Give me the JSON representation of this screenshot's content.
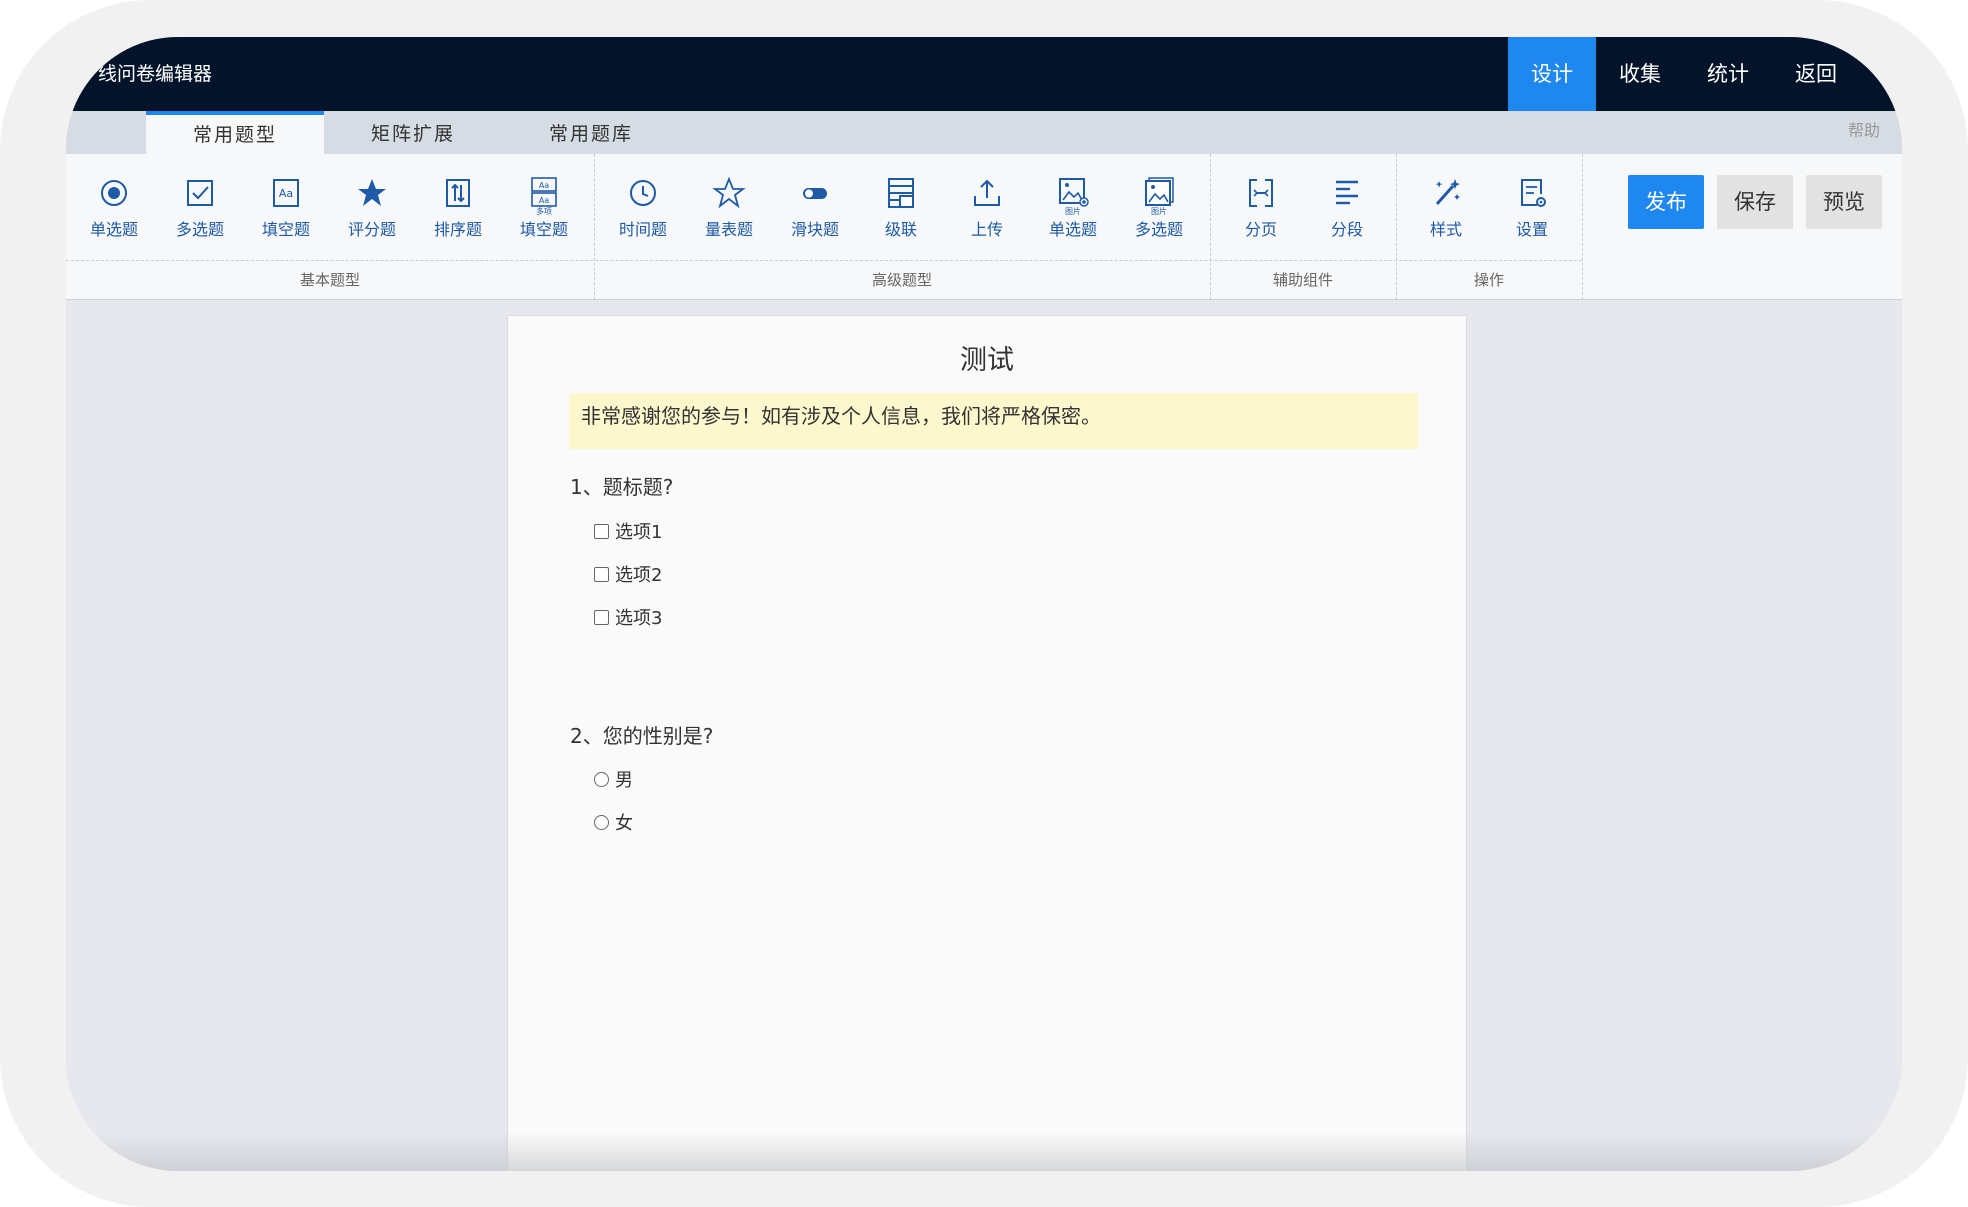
{
  "app": {
    "title": "线问卷编辑器"
  },
  "topnav": {
    "items": [
      "设计",
      "收集",
      "统计",
      "返回"
    ],
    "active": "设计"
  },
  "tabs": {
    "items": [
      "常用题型",
      "矩阵扩展",
      "常用题库"
    ],
    "active": "常用题型",
    "help": "帮助"
  },
  "toolbar": {
    "basic": [
      "单选题",
      "多选题",
      "填空题",
      "评分题",
      "排序题",
      "填空题"
    ],
    "advanced": [
      "时间题",
      "量表题",
      "滑块题",
      "级联",
      "上传",
      "单选题",
      "多选题"
    ],
    "aux": [
      "分页",
      "分段"
    ],
    "ops": [
      "样式",
      "设置"
    ],
    "group_labels": [
      "基本题型",
      "高级题型",
      "辅助组件",
      "操作"
    ],
    "badges": {
      "multi_fill": "多项",
      "image": "图片"
    },
    "buttons": {
      "publish": "发布",
      "save": "保存",
      "preview": "预览"
    }
  },
  "survey": {
    "title": "测试",
    "notice": "非常感谢您的参与！如有涉及个人信息，我们将严格保密。",
    "questions": [
      {
        "label": "1、题标题?",
        "type": "checkbox",
        "options": [
          "选项1",
          "选项2",
          "选项3"
        ]
      },
      {
        "label": "2、您的性别是?",
        "type": "radio",
        "options": [
          "男",
          "女"
        ]
      }
    ]
  },
  "colors": {
    "accent": "#1e87f0",
    "nav_bg": "#03142a",
    "icon": "#1f5aa6",
    "notice_bg": "#fdf7cd"
  }
}
